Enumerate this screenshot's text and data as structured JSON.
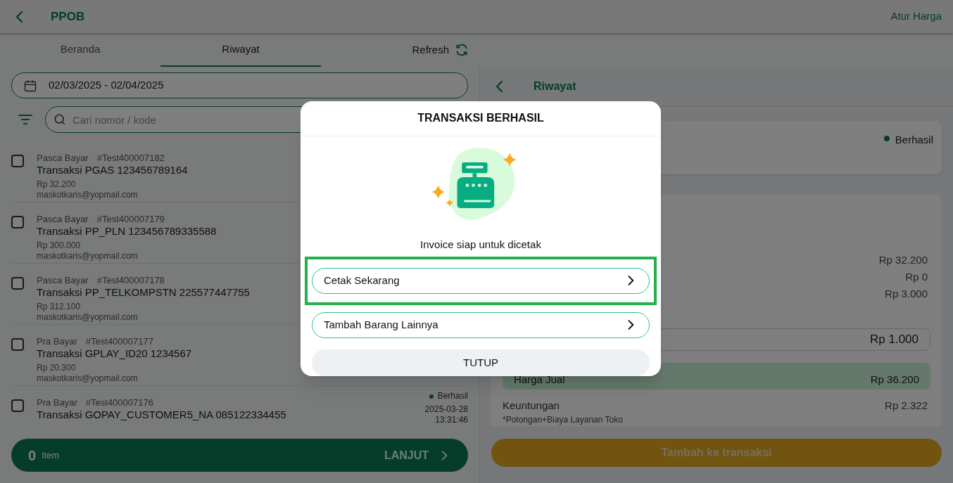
{
  "header": {
    "title": "PPOB",
    "action": "Atur Harga"
  },
  "tabs": [
    {
      "label": "Beranda",
      "selected": false
    },
    {
      "label": "Riwayat",
      "selected": true
    }
  ],
  "refresh": "Refresh",
  "date_range": "02/03/2025 - 02/04/2025",
  "search": {
    "placeholder": "Cari nomor / kode"
  },
  "transactions": [
    {
      "type": "Pasca Bayar",
      "code": "#Test400007182",
      "title": "Transaksi PGAS 123456789164",
      "amount": "Rp 32.200",
      "email": "maskotkaris@yopmail.com",
      "checked": false
    },
    {
      "type": "Pasca Bayar",
      "code": "#Test400007179",
      "title": "Transaksi PP_PLN 123456789335588",
      "amount": "Rp 300.000",
      "email": "maskotkaris@yopmail.com",
      "checked": false
    },
    {
      "type": "Pasca Bayar",
      "code": "#Test400007178",
      "title": "Transaksi PP_TELKOMPSTN 225577447755",
      "amount": "Rp 312.100",
      "email": "maskotkaris@yopmail.com",
      "checked": false
    },
    {
      "type": "Pra Bayar",
      "code": "#Test400007177",
      "title": "Transaksi GPLAY_ID20 1234567",
      "amount": "Rp 20.300",
      "email": "maskotkaris@yopmail.com",
      "checked": false
    },
    {
      "type": "Pra Bayar",
      "code": "#Test400007176",
      "title": "Transaksi GOPAY_CUSTOMER5_NA 085122334455",
      "checked": false,
      "status": "Berhasil",
      "date": "2025-03-28",
      "time": "13:31:46"
    }
  ],
  "bottom_bar": {
    "count": "0",
    "unit": "Item",
    "action": "LANJUT"
  },
  "detail": {
    "title": "Riwayat",
    "status": "Berhasil",
    "amounts": [
      "Rp 32.200",
      "Rp 0",
      "Rp 3.000"
    ],
    "fee_input": "Rp 1.000",
    "sell_price": {
      "label": "Harga Jual",
      "value": "Rp 36.200"
    },
    "profit": {
      "label": "Keuntungan",
      "value": "Rp 2.322",
      "note": "*Potongan+Biaya Layanan Toko"
    },
    "add_button": {
      "label": "Tambah ke transaksi",
      "disabled": true
    }
  },
  "modal": {
    "title": "TRANSAKSI BERHASIL",
    "message": "Invoice siap untuk dicetak",
    "options": [
      {
        "label": "Cetak Sekarang",
        "highlighted": true
      },
      {
        "label": "Tambah Barang Lainnya",
        "highlighted": false
      }
    ],
    "close": "TUTUP"
  }
}
